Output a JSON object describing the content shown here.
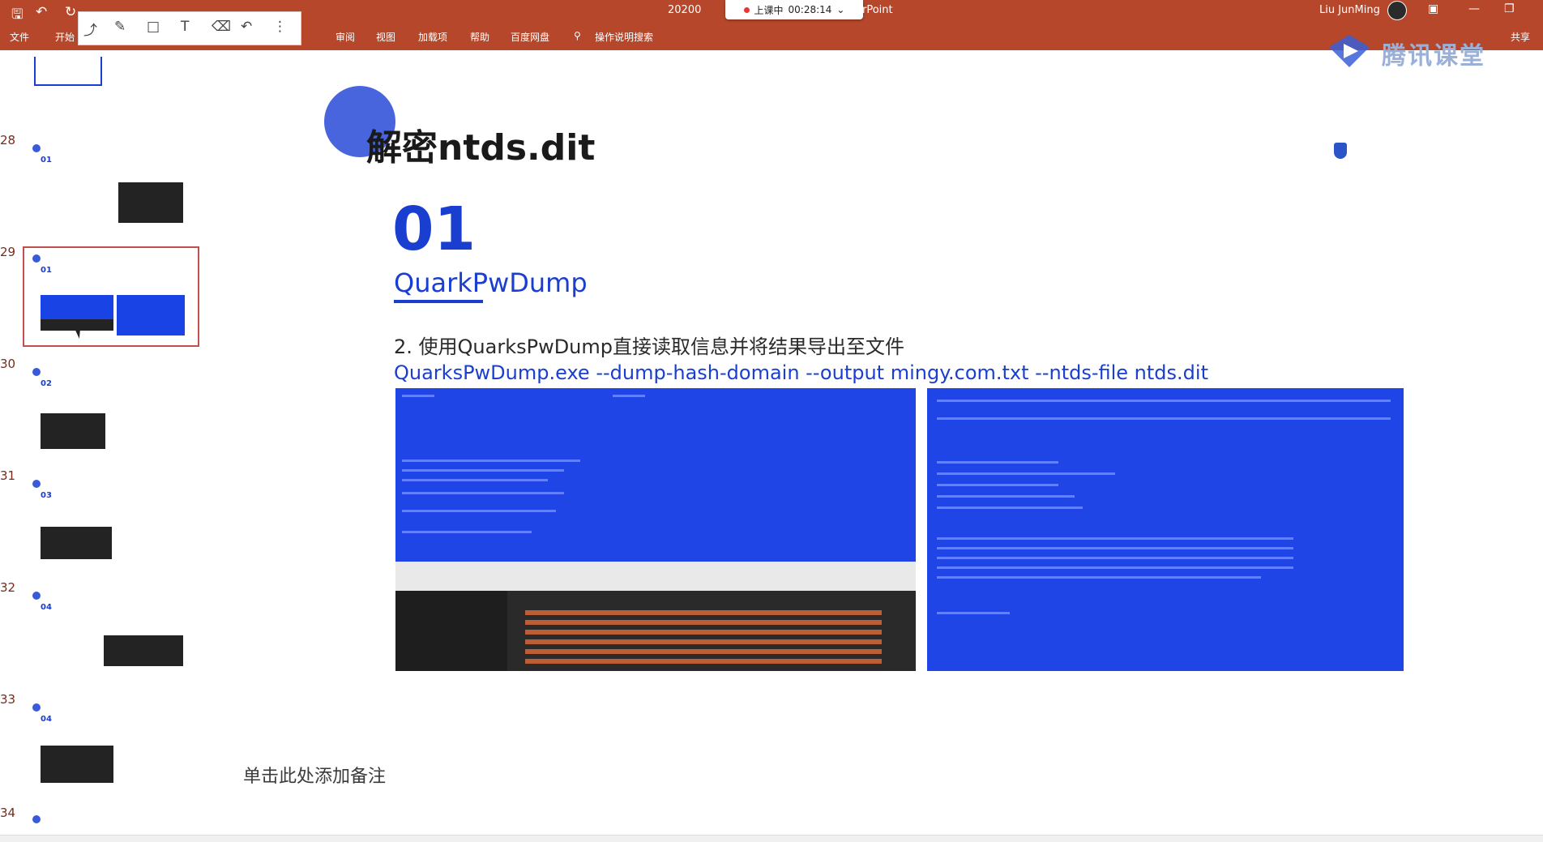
{
  "window": {
    "doc_title_fragment": "20200",
    "app_suffix": "rPoint",
    "live": {
      "status": "上课中",
      "timer": "00:28:14"
    },
    "user": "Liu JunMing"
  },
  "ribbon": {
    "tabs": [
      "文件",
      "开始",
      "审阅",
      "视图",
      "加载项",
      "帮助",
      "百度网盘",
      "操作说明搜索"
    ],
    "share": "共享"
  },
  "brand": {
    "text": "腾讯课堂"
  },
  "thumbnails": [
    {
      "num": "28",
      "label": "01"
    },
    {
      "num": "29",
      "label": "01",
      "active": true
    },
    {
      "num": "30",
      "label": "02"
    },
    {
      "num": "31",
      "label": "03"
    },
    {
      "num": "32",
      "label": "04"
    },
    {
      "num": "33",
      "label": "04"
    },
    {
      "num": "34",
      "label": ""
    }
  ],
  "slide": {
    "title": "解密ntds.dit",
    "number": "01",
    "section": "QuarkPwDump",
    "step": "2. 使用QuarksPwDump直接读取信息并将结果导出至文件",
    "command": "QuarksPwDump.exe --dump-hash-domain --output mingy.com.txt --ntds-file ntds.dit"
  },
  "notes_placeholder": "单击此处添加备注",
  "colors": {
    "ribbon": "#b7472a",
    "accent": "#1a3fd0",
    "screenshot_blue": "#1f45e6"
  }
}
